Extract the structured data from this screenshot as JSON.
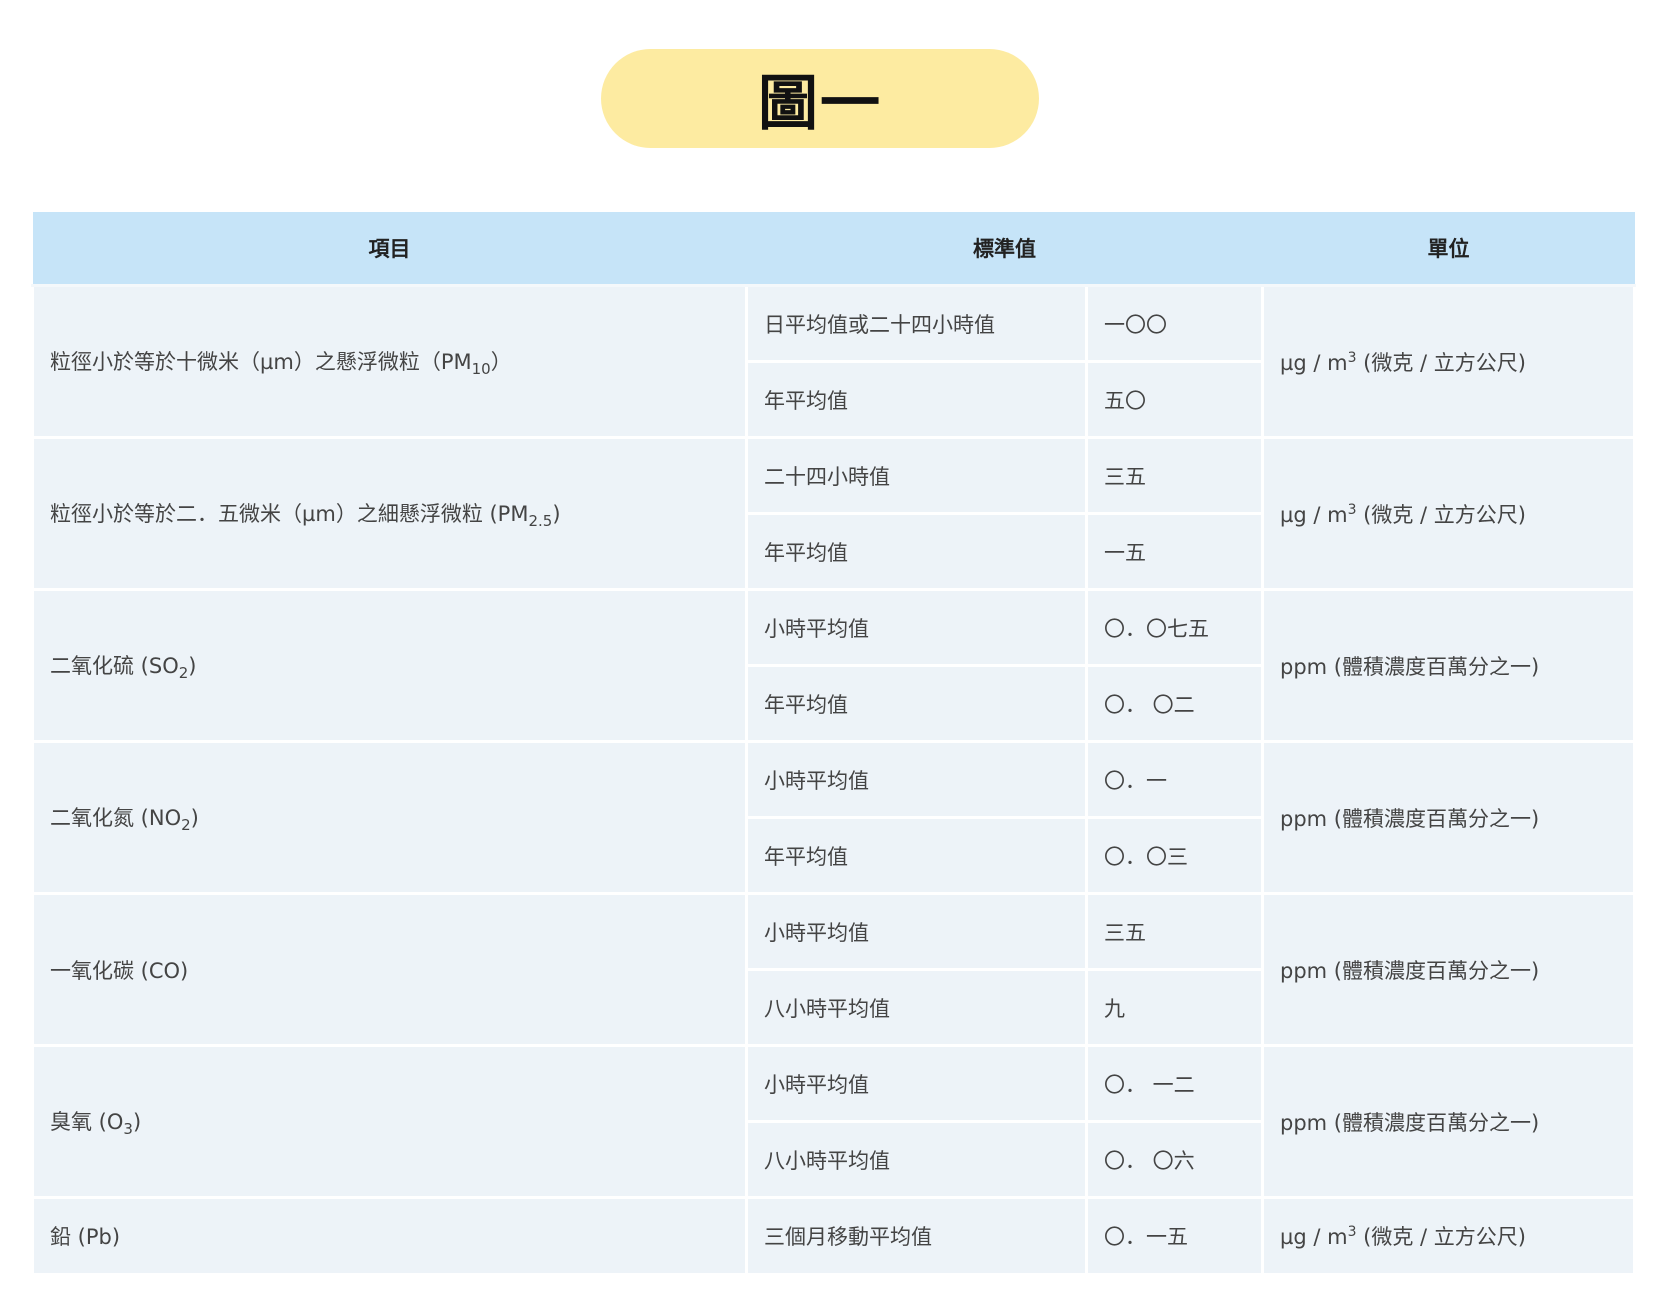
{
  "title": "圖一",
  "table": {
    "headers": {
      "item": "項目",
      "standard": "標準值",
      "unit": "單位"
    },
    "pollutants": [
      {
        "name": "粒徑小於等於十微米（µm）之懸浮微粒（PM",
        "sub": "10",
        "suffix": "）",
        "unit": {
          "pre": "µg / m",
          "sup": "3",
          "post": " (微克 / 立方公尺)"
        },
        "rows": [
          {
            "type": "日平均值或二十四小時值",
            "value": "一〇〇"
          },
          {
            "type": "年平均值",
            "value": "五〇"
          }
        ]
      },
      {
        "name": "粒徑小於等於二．五微米（µm）之細懸浮微粒 (PM",
        "sub": "2.5",
        "suffix": ")",
        "unit": {
          "pre": "µg / m",
          "sup": "3",
          "post": " (微克 / 立方公尺)"
        },
        "rows": [
          {
            "type": "二十四小時值",
            "value": "三五"
          },
          {
            "type": "年平均值",
            "value": "一五"
          }
        ]
      },
      {
        "name": "二氧化硫 (SO",
        "sub": "2",
        "suffix": ")",
        "unit": {
          "pre": "ppm (體積濃度百萬分之一)",
          "sup": "",
          "post": ""
        },
        "rows": [
          {
            "type": "小時平均值",
            "value": "〇．〇七五"
          },
          {
            "type": "年平均值",
            "value": "〇． 〇二"
          }
        ]
      },
      {
        "name": "二氧化氮 (NO",
        "sub": "2",
        "suffix": ")",
        "unit": {
          "pre": "ppm (體積濃度百萬分之一)",
          "sup": "",
          "post": ""
        },
        "rows": [
          {
            "type": "小時平均值",
            "value": "〇．一"
          },
          {
            "type": "年平均值",
            "value": "〇．〇三"
          }
        ]
      },
      {
        "name": "一氧化碳 (CO)",
        "sub": "",
        "suffix": "",
        "unit": {
          "pre": "ppm (體積濃度百萬分之一)",
          "sup": "",
          "post": ""
        },
        "rows": [
          {
            "type": "小時平均值",
            "value": "三五"
          },
          {
            "type": "八小時平均值",
            "value": "九"
          }
        ]
      },
      {
        "name": "臭氧 (O",
        "sub": "3",
        "suffix": ")",
        "unit": {
          "pre": "ppm (體積濃度百萬分之一)",
          "sup": "",
          "post": ""
        },
        "rows": [
          {
            "type": "小時平均值",
            "value": "〇． 一二"
          },
          {
            "type": "八小時平均值",
            "value": "〇． 〇六"
          }
        ]
      },
      {
        "name": "鉛 (Pb)",
        "sub": "",
        "suffix": "",
        "unit": {
          "pre": "µg / m",
          "sup": "3",
          "post": " (微克 / 立方公尺)"
        },
        "rows": [
          {
            "type": "三個月移動平均值",
            "value": "〇．一五"
          }
        ]
      }
    ]
  }
}
